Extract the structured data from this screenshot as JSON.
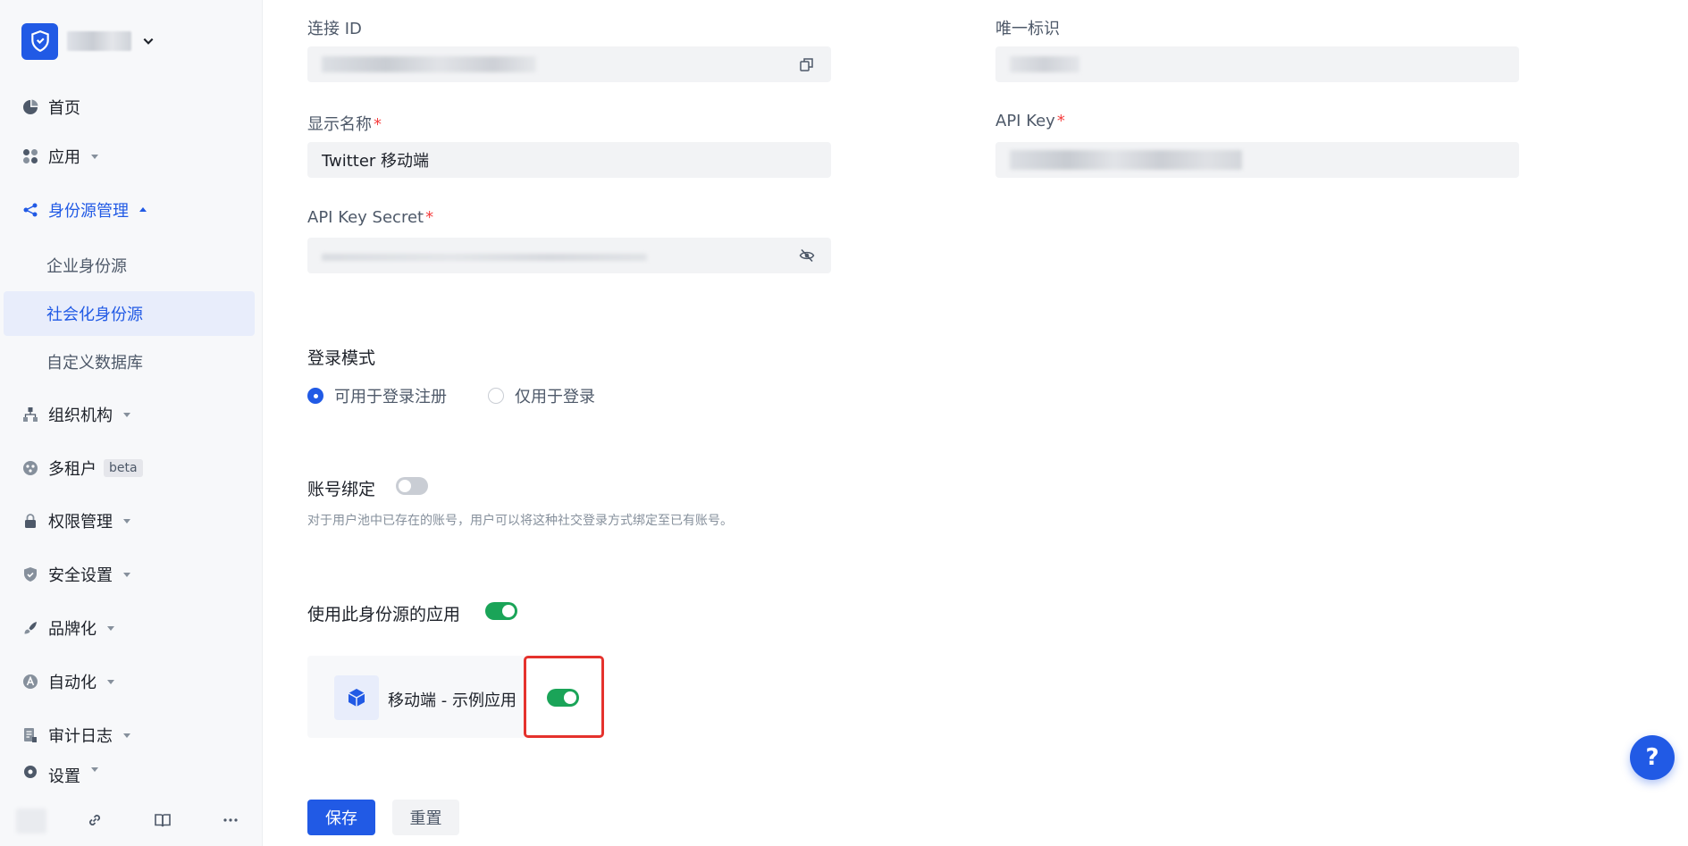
{
  "sidebar": {
    "nav": [
      {
        "label": "首页",
        "icon": "pie-chart-icon",
        "has_caret": false
      },
      {
        "label": "应用",
        "icon": "apps-grid-icon",
        "has_caret": true
      },
      {
        "label": "身份源管理",
        "icon": "share-nodes-icon",
        "has_caret": true,
        "expanded": true
      },
      {
        "label": "组织机构",
        "icon": "org-tree-icon",
        "has_caret": true
      },
      {
        "label": "多租户",
        "icon": "tenant-icon",
        "badge": "beta"
      },
      {
        "label": "权限管理",
        "icon": "lock-icon",
        "has_caret": true
      },
      {
        "label": "安全设置",
        "icon": "shield-check-icon",
        "has_caret": true
      },
      {
        "label": "品牌化",
        "icon": "brush-icon",
        "has_caret": true
      },
      {
        "label": "自动化",
        "icon": "automation-a-icon",
        "has_caret": true
      },
      {
        "label": "审计日志",
        "icon": "audit-log-icon",
        "has_caret": true
      },
      {
        "label": "设置",
        "icon": "settings-icon",
        "has_caret": true
      }
    ],
    "sub_items": [
      "企业身份源",
      "社会化身份源",
      "自定义数据库"
    ],
    "selected_sub": "社会化身份源"
  },
  "form": {
    "connection_id_label": "连接 ID",
    "unique_id_label": "唯一标识",
    "display_name_label": "显示名称",
    "display_name_value": "Twitter 移动端",
    "api_key_label": "API Key",
    "api_secret_label": "API Key Secret",
    "required_mark": "*"
  },
  "login_mode": {
    "title": "登录模式",
    "options": [
      "可用于登录注册",
      "仅用于登录"
    ],
    "selected": "可用于登录注册"
  },
  "account_binding": {
    "title": "账号绑定",
    "enabled": false,
    "hint": "对于用户池中已存在的账号，用户可以将这种社交登录方式绑定至已有账号。"
  },
  "apps_section": {
    "title": "使用此身份源的应用",
    "enabled": true,
    "apps": [
      {
        "name": "移动端 - 示例应用",
        "enabled": true
      }
    ]
  },
  "actions": {
    "save": "保存",
    "reset": "重置"
  },
  "help": {
    "label": "?"
  },
  "colors": {
    "primary": "#215ae5",
    "toggle_on": "#1aa458",
    "required": "#f53f3f",
    "highlight": "#e5322d"
  }
}
